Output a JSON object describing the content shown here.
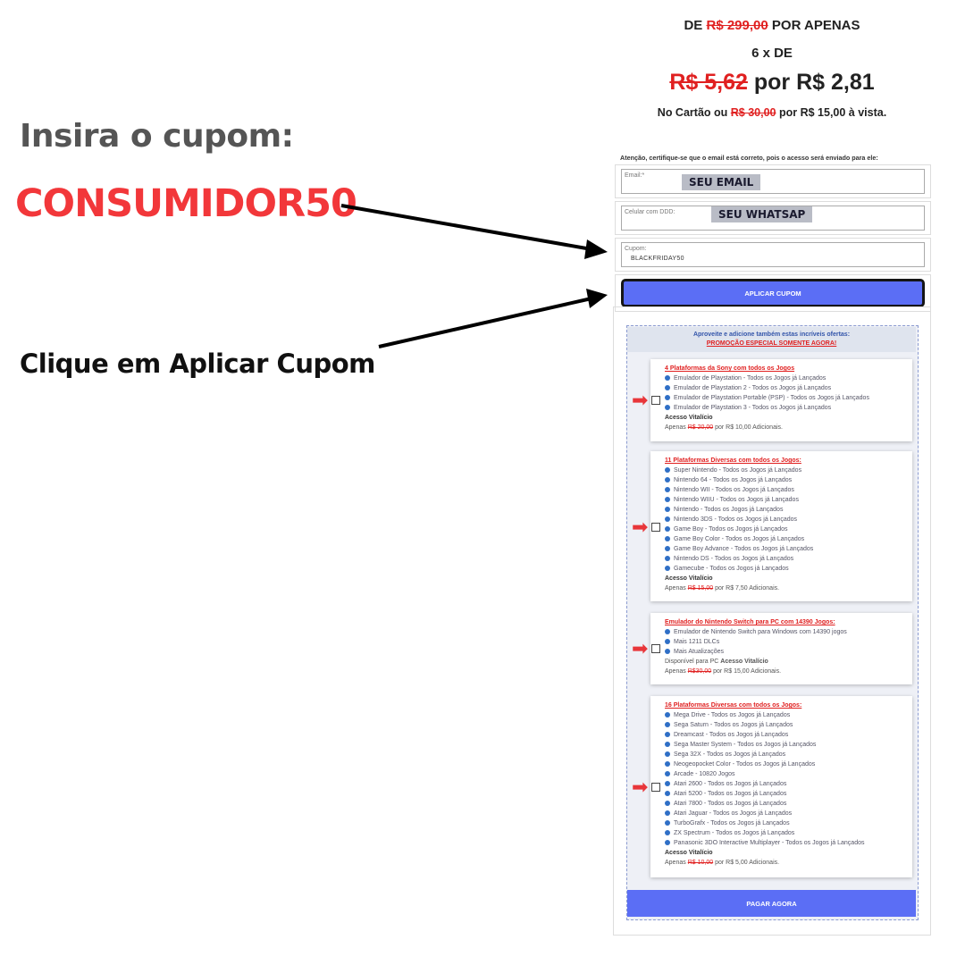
{
  "left": {
    "instruction": "Insira o cupom:",
    "coupon_code": "CONSUMIDOR50",
    "click_instruction": "Clique em Aplicar Cupom"
  },
  "price": {
    "line1_prefix": "DE",
    "line1_old": "R$ 299,00",
    "line1_suffix": "POR APENAS",
    "installments": "6 x DE",
    "big_old": "R$ 5,62",
    "big_new": "por R$ 2,81",
    "card_prefix": "No Cartão ou",
    "card_old": "R$ 30,00",
    "card_suffix": "por R$ 15,00 à vista."
  },
  "form": {
    "attention": "Atenção, certifique-se que o email está correto, pois o acesso será enviado para ele:",
    "email_label": "Email:*",
    "email_tag": "SEU EMAIL",
    "phone_label": "Celular com DDD:",
    "phone_tag": "SEU WHATSAP",
    "coupon_label": "Cupom:",
    "coupon_value": "BLACKFRIDAY50",
    "apply_label": "APLICAR CUPOM"
  },
  "offers": {
    "header_line1": "Aproveite e adicione também estas incríveis ofertas:",
    "header_line2": "PROMOÇÃO ESPECIAL SOMENTE AGORA!",
    "cards": [
      {
        "title": "4 Plataformas da Sony com todos os Jogos",
        "items": [
          "Emulador de Playstation - Todos os Jogos já Lançados",
          "Emulador de Playstation 2 - Todos os Jogos já Lançados",
          "Emulador de Playstation Portable (PSP) - Todos os Jogos já Lançados",
          "Emulador de Playstation 3 - Todos os Jogos já Lançados"
        ],
        "access": "Acesso Vitalício",
        "price_prefix": "Apenas",
        "price_old": "R$ 20,00",
        "price_suffix": "por R$ 10,00 Adicionais."
      },
      {
        "title": "11 Plataformas Diversas com todos os Jogos:",
        "items": [
          "Super Nintendo - Todos os Jogos já Lançados",
          "Nintendo 64 - Todos os Jogos já Lançados",
          "Nintendo WII - Todos os Jogos já Lançados",
          "Nintendo WIIU - Todos os Jogos já Lançados",
          "Nintendo - Todos os Jogos já Lançados",
          "Nintendo 3DS - Todos os Jogos já Lançados",
          "Game Boy - Todos os Jogos já Lançados",
          "Game Boy Color - Todos os Jogos já Lançados",
          "Game Boy Advance - Todos os Jogos já Lançados",
          "Nintendo DS - Todos os Jogos já Lançados",
          "Gamecube - Todos os Jogos já Lançados"
        ],
        "access": "Acesso Vitalício",
        "price_prefix": "Apenas",
        "price_old": "R$ 15,00",
        "price_suffix": "por R$ 7,50 Adicionais."
      },
      {
        "title": "Emulador do Nintendo Switch para PC com 14390 Jogos:",
        "items": [
          "Emulador de Nintendo Switch para Windows com 14390 jogos",
          "Mais 1211 DLCs",
          "Mais Atualizações"
        ],
        "access_prefix": "Disponível para PC",
        "access": "Acesso Vitalício",
        "price_prefix": "Apenas",
        "price_old": "R$30,00",
        "price_suffix": "por R$ 15,00 Adicionais."
      },
      {
        "title": "16 Plataformas Diversas com todos os Jogos:",
        "items": [
          "Mega Drive - Todos os Jogos já Lançados",
          "Sega Saturn - Todos os Jogos já Lançados",
          "Dreamcast - Todos os Jogos já Lançados",
          "Sega Master System - Todos os Jogos já Lançados",
          "Sega 32X - Todos os Jogos já Lançados",
          "Neogeopocket Color - Todos os Jogos já Lançados",
          "Arcade - 10820 Jogos",
          "Atari 2600 - Todos os Jogos já Lançados",
          "Atari 5200 - Todos os Jogos já Lançados",
          "Atari 7800 - Todos os Jogos já Lançados",
          "Atari Jaguar - Todos os Jogos já Lançados",
          "TurboGrafx - Todos os Jogos já Lançados",
          "ZX Spectrum - Todos os Jogos já Lançados",
          "Panasonic 3DO Interactive Multiplayer - Todos os Jogos já Lançados"
        ],
        "access": "Acesso Vitalício",
        "price_prefix": "Apenas",
        "price_old": "R$ 10,00",
        "price_suffix": "por R$ 5,00 Adicionais."
      }
    ],
    "pay_label": "PAGAR AGORA"
  },
  "colors": {
    "accent_red": "#f2373a",
    "button_blue": "#5b6ef5",
    "bullet_blue": "#2f6fc6"
  }
}
